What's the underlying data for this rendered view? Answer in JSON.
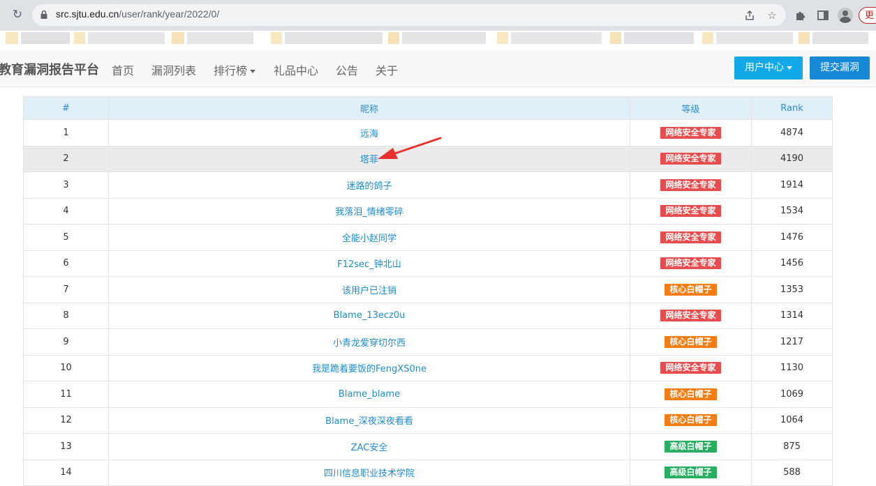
{
  "browser": {
    "url_host": "src.sjtu.edu.cn",
    "url_path": "/user/rank/year/2022/0/",
    "update_label": "更"
  },
  "navbar": {
    "brand": "教育漏洞报告平台",
    "links": [
      "首页",
      "漏洞列表",
      "排行榜",
      "礼品中心",
      "公告",
      "关于"
    ],
    "user_center": "用户中心",
    "submit": "提交漏洞"
  },
  "table": {
    "headers": [
      "#",
      "昵称",
      "等级",
      "Rank"
    ],
    "rows": [
      {
        "num": "1",
        "nickname": "远海",
        "level": "网络安全专家",
        "rank": "4874"
      },
      {
        "num": "2",
        "nickname": "塔菲",
        "level": "网络安全专家",
        "rank": "4190"
      },
      {
        "num": "3",
        "nickname": "迷路的鸽子",
        "level": "网络安全专家",
        "rank": "1914"
      },
      {
        "num": "4",
        "nickname": "我落泪_情绪零碎",
        "level": "网络安全专家",
        "rank": "1534"
      },
      {
        "num": "5",
        "nickname": "全能小赵同学",
        "level": "网络安全专家",
        "rank": "1476"
      },
      {
        "num": "6",
        "nickname": "F12sec_钟北山",
        "level": "网络安全专家",
        "rank": "1456"
      },
      {
        "num": "7",
        "nickname": "该用户已注销",
        "level": "核心白帽子",
        "rank": "1353"
      },
      {
        "num": "8",
        "nickname": "Blame_13ecz0u",
        "level": "网络安全专家",
        "rank": "1314"
      },
      {
        "num": "9",
        "nickname": "小青龙爱穿切尔西",
        "level": "核心白帽子",
        "rank": "1217"
      },
      {
        "num": "10",
        "nickname": "我是跪着要饭的FengXS0ne",
        "level": "网络安全专家",
        "rank": "1130"
      },
      {
        "num": "11",
        "nickname": "Blame_blame",
        "level": "核心白帽子",
        "rank": "1069"
      },
      {
        "num": "12",
        "nickname": "Blame_深夜深夜看看",
        "level": "核心白帽子",
        "rank": "1064"
      },
      {
        "num": "13",
        "nickname": "ZAC安全",
        "level": "高级白帽子",
        "rank": "875"
      },
      {
        "num": "14",
        "nickname": "四川信息职业技术学院",
        "level": "高级白帽子",
        "rank": "588"
      }
    ]
  },
  "highlighted_row": "2",
  "colors": {
    "网络安全专家": "#e94c4c",
    "核心白帽子": "#f57c12",
    "高级白帽子": "#27ae60",
    "user_center_btn": "#13a8e8",
    "submit_btn": "#1789d6",
    "annotation_arrow": "#e8322e"
  },
  "icons": {
    "reload": "reload-icon",
    "lock": "lock-icon",
    "share": "share-icon",
    "bookmark_star": "star-icon",
    "extensions": "puzzle-icon",
    "side_panel": "side-panel-icon",
    "profile": "avatar-icon",
    "annotation": "red-arrow-icon"
  }
}
